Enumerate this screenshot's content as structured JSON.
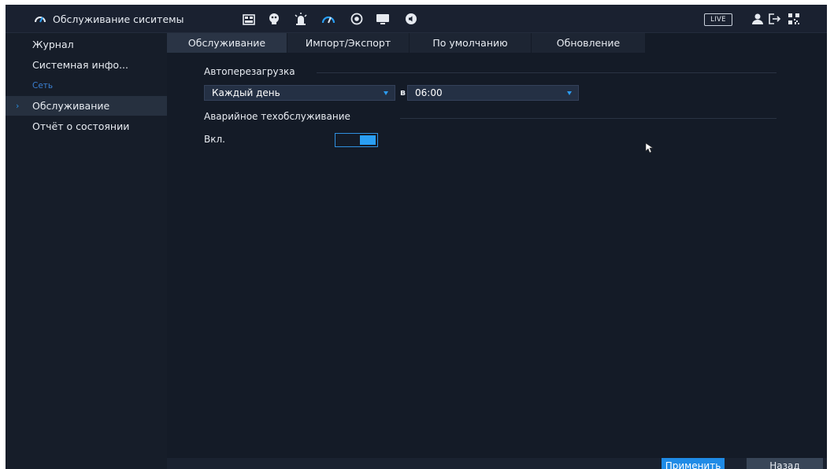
{
  "header": {
    "title": "Обслуживание сиситемы",
    "live_label": "LIVE",
    "icons": [
      "gauge-icon",
      "film-icon",
      "face-icon",
      "alarm-icon",
      "gauge-icon",
      "disk-icon",
      "monitor-icon",
      "speaker-icon",
      "user-icon",
      "logout-icon",
      "qr-icon"
    ]
  },
  "sidebar": {
    "items": [
      {
        "label": "Журнал"
      },
      {
        "label": "Системная инфо..."
      },
      {
        "label": "Сеть"
      },
      {
        "label": "Обслуживание"
      },
      {
        "label": "Отчёт о состоянии"
      }
    ],
    "active": "Обслуживание"
  },
  "tabs": [
    {
      "label": "Обслуживание"
    },
    {
      "label": "Импорт/Экспорт"
    },
    {
      "label": "По умолчанию"
    },
    {
      "label": "Обновление"
    }
  ],
  "content": {
    "auto_reboot": {
      "section": "Автоперезагрузка",
      "day_value": "Каждый день",
      "at_label": "в",
      "time_value": "06:00"
    },
    "emergency": {
      "section": "Аварийное техобслуживание",
      "enable_label": "Вкл.",
      "enabled": true
    }
  },
  "footer": {
    "apply_label": "Применить",
    "back_label": "Назад"
  },
  "colors": {
    "background": "#141b27",
    "accent": "#2a9ff4",
    "sidebar_link": "#3a7fd1"
  }
}
